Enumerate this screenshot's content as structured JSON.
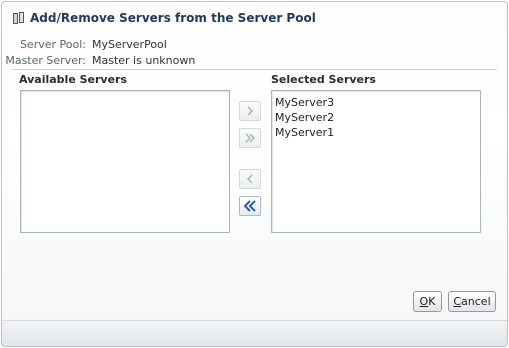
{
  "dialog": {
    "title": "Add/Remove Servers from the Server Pool",
    "icon": "server-pool-icon"
  },
  "info": {
    "server_pool_label": "Server Pool:",
    "server_pool_value": "MyServerPool",
    "master_server_label": "Master Server:",
    "master_server_value": "Master is unknown"
  },
  "available": {
    "header": "Available Servers",
    "items": []
  },
  "selected": {
    "header": "Selected Servers",
    "items": [
      "MyServer3",
      "MyServer2",
      "MyServer1"
    ]
  },
  "shuttle": {
    "move": {
      "icon": "move-right-icon",
      "enabled": false
    },
    "move_all": {
      "icon": "move-all-right-icon",
      "enabled": false
    },
    "remove": {
      "icon": "move-left-icon",
      "enabled": false
    },
    "remove_all": {
      "icon": "move-all-left-icon",
      "enabled": true
    }
  },
  "buttons": {
    "ok_mnemonic": "O",
    "ok_rest": "K",
    "cancel_mnemonic": "C",
    "cancel_rest": "ancel"
  },
  "colors": {
    "title": "#1f3a5c",
    "enabled_icon": "#2a5ea8",
    "disabled_icon": "#a8b0b7"
  }
}
